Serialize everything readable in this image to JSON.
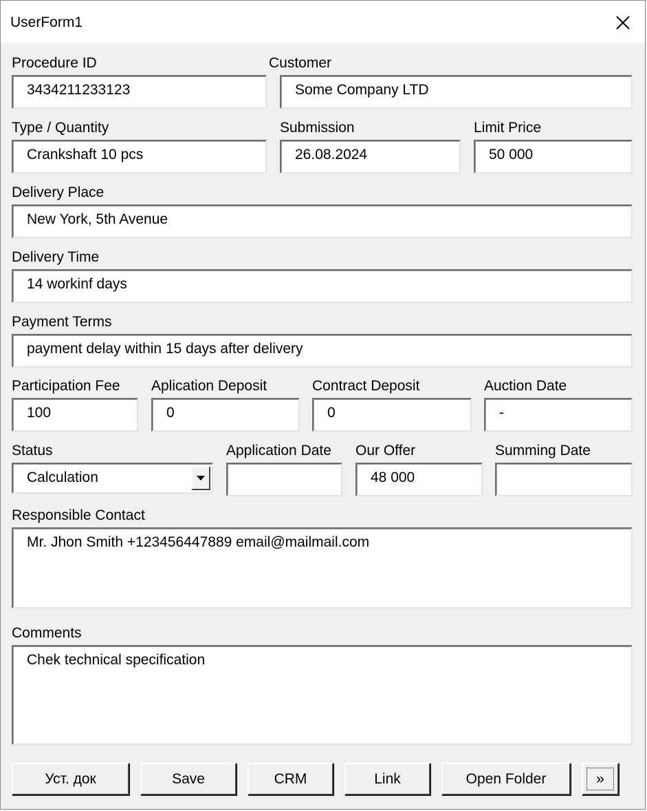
{
  "window": {
    "title": "UserForm1"
  },
  "procedure_id": {
    "label": "Procedure ID",
    "value": "3434211233123"
  },
  "customer": {
    "label": "Customer",
    "value": "Some Company LTD"
  },
  "type_quantity": {
    "label": "Type / Quantity",
    "value": "Crankshaft 10 pcs"
  },
  "submission": {
    "label": "Submission",
    "value": "26.08.2024"
  },
  "limit_price": {
    "label": "Limit Price",
    "value": "50 000"
  },
  "delivery_place": {
    "label": "Delivery Place",
    "value": "New York, 5th Avenue"
  },
  "delivery_time": {
    "label": "Delivery Time",
    "value": "14 workinf days"
  },
  "payment_terms": {
    "label": "Payment Terms",
    "value": "payment delay within 15 days after delivery"
  },
  "participation_fee": {
    "label": "Participation Fee",
    "value": "100"
  },
  "application_deposit": {
    "label": "Aplication Deposit",
    "value": "0"
  },
  "contract_deposit": {
    "label": "Contract Deposit",
    "value": "0"
  },
  "auction_date": {
    "label": "Auction Date",
    "value": "-"
  },
  "status": {
    "label": "Status",
    "value": "Calculation"
  },
  "application_date": {
    "label": "Application Date",
    "value": ""
  },
  "our_offer": {
    "label": "Our Offer",
    "value": "48 000"
  },
  "summing_date": {
    "label": "Summing Date",
    "value": ""
  },
  "responsible_contact": {
    "label": "Responsible Contact",
    "value": "Mr. Jhon Smith +123456447889 email@mailmail.com"
  },
  "comments": {
    "label": "Comments",
    "value": "Chek technical specification"
  },
  "buttons": {
    "ust_dok": "Уст. док",
    "save": "Save",
    "crm": "CRM",
    "link": "Link",
    "open_folder": "Open Folder",
    "more": "»"
  }
}
